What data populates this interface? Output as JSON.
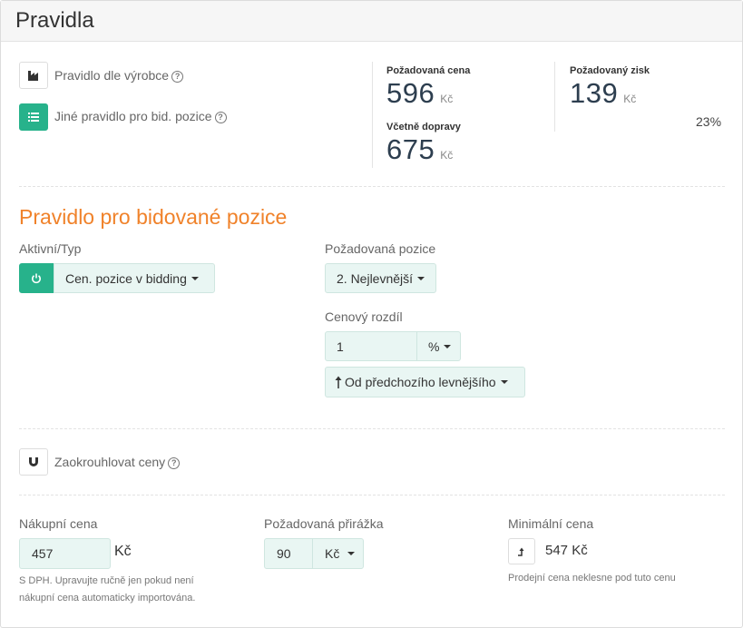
{
  "header": {
    "title": "Pravidla"
  },
  "rules": {
    "manufacturer_rule_label": "Pravidlo dle výrobce",
    "bid_rule_label": "Jiné pravidlo pro bid. pozice"
  },
  "stats": {
    "required_price_label": "Požadovaná cena",
    "required_price_value": "596",
    "required_price_unit": "Kč",
    "incl_shipping_label": "Včetně dopravy",
    "incl_shipping_value": "675",
    "incl_shipping_unit": "Kč",
    "required_profit_label": "Požadovaný zisk",
    "required_profit_value": "139",
    "required_profit_unit": "Kč",
    "profit_percent": "23%"
  },
  "bid_section": {
    "title": "Pravidlo pro bidované pozice",
    "active_type_label": "Aktivní/Typ",
    "type_value": "Cen. pozice v bidding",
    "position_label": "Požadovaná pozice",
    "position_value": "2. Nejlevnější",
    "price_diff_label": "Cenový rozdíl",
    "price_diff_value": "1",
    "price_diff_unit": "%",
    "direction_value": "Od předchozího levnějšího"
  },
  "rounding": {
    "label": "Zaokrouhlovat ceny"
  },
  "pricing": {
    "purchase_label": "Nákupní cena",
    "purchase_value": "457",
    "purchase_unit": "Kč",
    "purchase_note_line1": "S DPH. Upravujte ručně jen pokud není",
    "purchase_note_line2": "nákupní cena automaticky importována.",
    "markup_label": "Požadovaná přirážka",
    "markup_value": "90",
    "markup_unit": "Kč",
    "min_price_label": "Minimální cena",
    "min_price_value": "547 Kč",
    "min_price_note": "Prodejní cena neklesne pod tuto cenu"
  },
  "colors": {
    "accent_green": "#27b28b",
    "accent_orange": "#f0822a",
    "field_bg": "#e9f6f3"
  }
}
